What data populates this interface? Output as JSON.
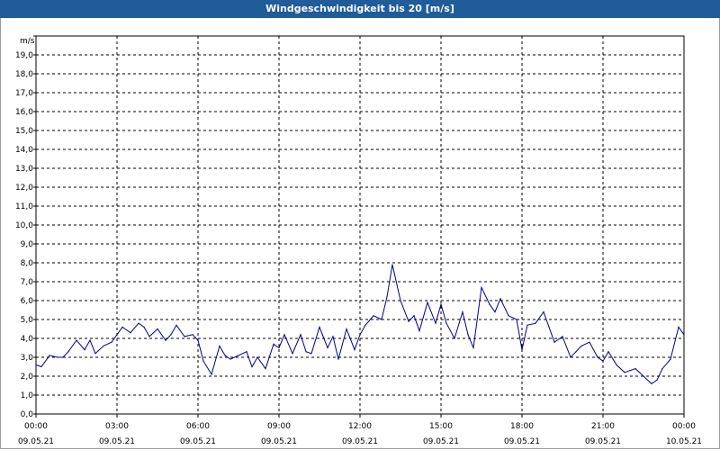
{
  "title": "Windgeschwindigkeit bis 20 [m/s]",
  "colors": {
    "titlebar": "#1f5c99",
    "line": "#00008b",
    "grid": "#000000"
  },
  "chart_data": {
    "type": "line",
    "title": "Windgeschwindigkeit bis 20 [m/s]",
    "ylabel": "m/s",
    "xlabel": "",
    "ylim": [
      0,
      20
    ],
    "y_ticks": [
      "0,0",
      "1,0",
      "2,0",
      "3,0",
      "4,0",
      "5,0",
      "6,0",
      "7,0",
      "8,0",
      "9,0",
      "10,0",
      "11,0",
      "12,0",
      "13,0",
      "14,0",
      "15,0",
      "16,0",
      "17,0",
      "18,0",
      "19,0"
    ],
    "x_ticks": [
      {
        "time": "00:00",
        "date": "09.05.21"
      },
      {
        "time": "03:00",
        "date": "09.05.21"
      },
      {
        "time": "06:00",
        "date": "09.05.21"
      },
      {
        "time": "09:00",
        "date": "09.05.21"
      },
      {
        "time": "12:00",
        "date": "09.05.21"
      },
      {
        "time": "15:00",
        "date": "09.05.21"
      },
      {
        "time": "18:00",
        "date": "09.05.21"
      },
      {
        "time": "21:00",
        "date": "09.05.21"
      },
      {
        "time": "00:00",
        "date": "10.05.21"
      }
    ],
    "grid": true,
    "series": [
      {
        "x_unit": "hours since 09.05.21 00:00",
        "x": [
          0.0,
          0.2,
          0.5,
          0.8,
          1.0,
          1.2,
          1.5,
          1.8,
          2.0,
          2.2,
          2.5,
          2.8,
          3.0,
          3.2,
          3.5,
          3.8,
          4.0,
          4.2,
          4.5,
          4.8,
          5.0,
          5.2,
          5.5,
          5.8,
          6.0,
          6.2,
          6.5,
          6.8,
          7.0,
          7.2,
          7.5,
          7.8,
          8.0,
          8.2,
          8.5,
          8.8,
          9.0,
          9.2,
          9.5,
          9.8,
          10.0,
          10.2,
          10.5,
          10.8,
          11.0,
          11.2,
          11.5,
          11.8,
          12.0,
          12.2,
          12.5,
          12.8,
          13.0,
          13.2,
          13.5,
          13.8,
          14.0,
          14.2,
          14.5,
          14.8,
          15.0,
          15.2,
          15.5,
          15.8,
          16.0,
          16.2,
          16.5,
          16.8,
          17.0,
          17.2,
          17.5,
          17.8,
          18.0,
          18.2,
          18.5,
          18.8,
          19.0,
          19.2,
          19.5,
          19.8,
          20.0,
          20.2,
          20.5,
          20.8,
          21.0,
          21.2,
          21.5,
          21.8,
          22.0,
          22.2,
          22.5,
          22.8,
          23.0,
          23.2,
          23.5,
          23.8,
          24.0
        ],
        "values": [
          2.6,
          2.5,
          3.1,
          3.0,
          3.0,
          3.3,
          3.9,
          3.4,
          3.9,
          3.2,
          3.6,
          3.8,
          4.2,
          4.6,
          4.3,
          4.8,
          4.6,
          4.1,
          4.5,
          3.9,
          4.2,
          4.7,
          4.1,
          4.2,
          3.9,
          2.8,
          2.1,
          3.6,
          3.1,
          2.9,
          3.1,
          3.3,
          2.5,
          3.0,
          2.4,
          3.7,
          3.5,
          4.2,
          3.2,
          4.2,
          3.3,
          3.2,
          4.6,
          3.5,
          4.1,
          2.9,
          4.5,
          3.4,
          4.2,
          4.7,
          5.2,
          5.0,
          6.2,
          7.9,
          6.0,
          4.9,
          5.2,
          4.4,
          5.9,
          4.8,
          5.8,
          4.8,
          4.0,
          5.4,
          4.2,
          3.5,
          6.7,
          5.8,
          5.4,
          6.1,
          5.2,
          5.0,
          3.4,
          4.7,
          4.8,
          5.4,
          4.6,
          3.8,
          4.1,
          3.0,
          3.3,
          3.6,
          3.8,
          3.0,
          2.8,
          3.3,
          2.6,
          2.2,
          2.3,
          2.4,
          2.0,
          1.6,
          1.8,
          2.4,
          2.9,
          4.6,
          4.2
        ]
      }
    ]
  }
}
